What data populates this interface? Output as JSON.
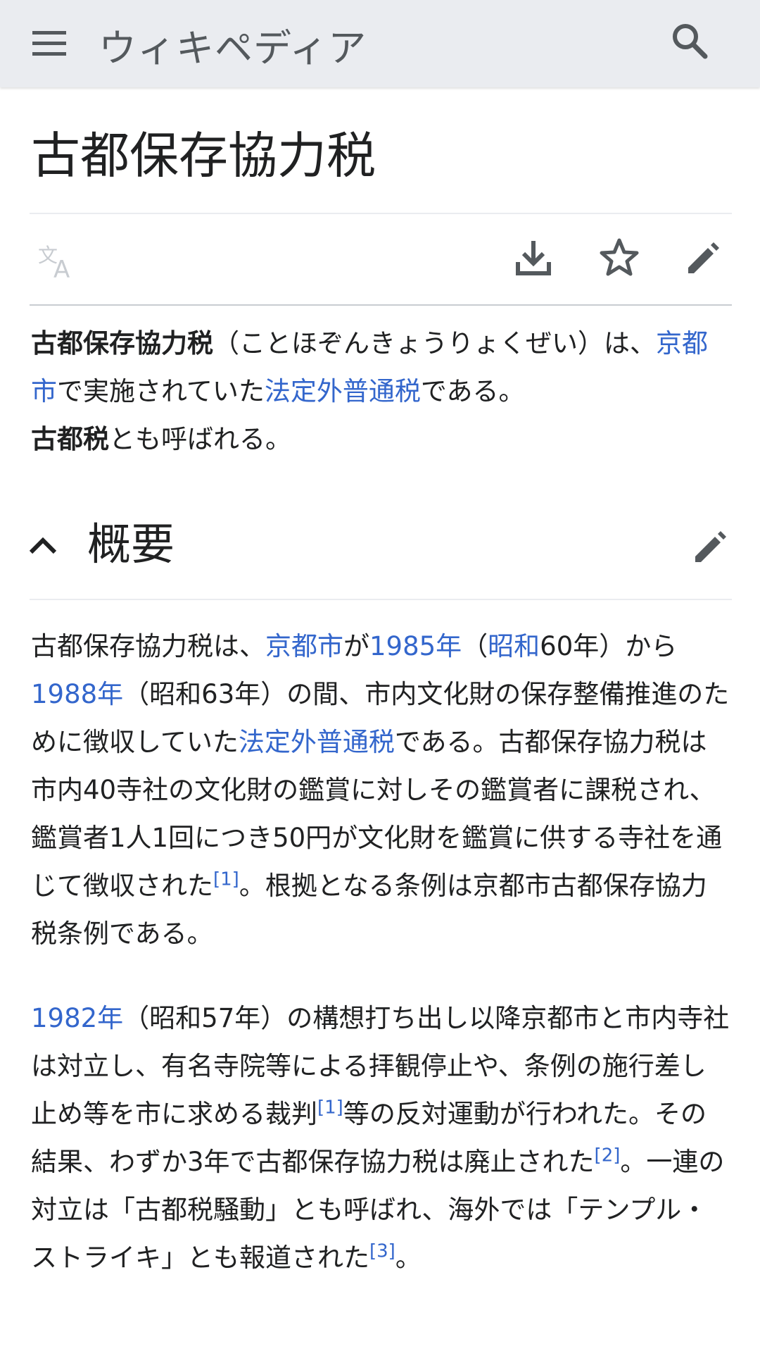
{
  "header": {
    "logo": "ウィキペディア",
    "menu_icon": "hamburger-menu-icon",
    "search_icon": "search-icon"
  },
  "page": {
    "title": "古都保存協力税"
  },
  "toolbar": {
    "language_icon": "language-icon",
    "download_icon": "download-icon",
    "watch_icon": "star-icon",
    "edit_icon": "edit-pencil-icon"
  },
  "intro": {
    "term": "古都保存協力税",
    "reading": "（ことほぞんきょうりょくぜい）は、",
    "link_kyoto": "京都市",
    "text_1": "で実施されていた",
    "link_tax": "法定外普通税",
    "text_2": "である。",
    "alias": "古都税",
    "text_3": "とも呼ばれる。"
  },
  "section": {
    "title": "概要",
    "chevron_icon": "chevron-up-icon",
    "edit_icon": "edit-pencil-icon",
    "p1": {
      "t1": "古都保存協力税は、",
      "l1": "京都市",
      "t2": "が",
      "l2": "1985年",
      "t3": "（",
      "l3": "昭和",
      "t4": "60年）から",
      "l4": "1988年",
      "t5": "（昭和63年）の間、市内文化財の保存整備推進のために徴収していた",
      "l5": "法定外普通税",
      "t6": "である。古都保存協力税は市内40寺社の文化財の鑑賞に対しその鑑賞者に課税され、鑑賞者1人1回につき50円が文化財を鑑賞に供する寺社を通じて徴収された",
      "r1": "[1]",
      "t7": "。根拠となる条例は京都市古都保存協力税条例である。"
    },
    "p2": {
      "l1": "1982年",
      "t1": "（昭和57年）の構想打ち出し以降京都市と市内寺社は対立し、有名寺院等による拝観停止や、条例の施行差し止め等を市に求める裁判",
      "r1": "[1]",
      "t2": "等の反対運動が行われた。その結果、わずか3年で古都保存協力税は廃止された",
      "r2": "[2]",
      "t3": "。一連の対立は「古都税騒動」とも呼ばれ、海外では「テンプル・ストライキ」とも報道された",
      "r3": "[3]",
      "t4": "。"
    }
  },
  "colors": {
    "header_bg": "#eaecf0",
    "link": "#3366cc",
    "text": "#202122",
    "icon": "#54595d"
  }
}
